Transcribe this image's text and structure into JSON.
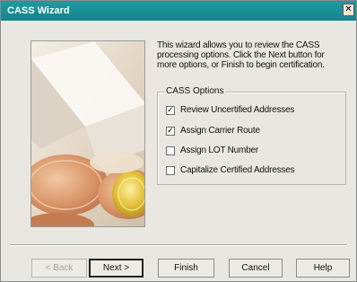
{
  "window": {
    "title": "CASS Wizard"
  },
  "intro_text": "This wizard allows you to review the CASS processing options. Click the Next button for more options, or Finish to begin certification.",
  "options_group": {
    "label": "CASS Options",
    "items": [
      {
        "label": "Review Uncertified Addresses",
        "checked": true
      },
      {
        "label": "Assign Carrier Route",
        "checked": true
      },
      {
        "label": "Assign LOT Number",
        "checked": false
      },
      {
        "label": "Capitalize Certified Addresses",
        "checked": false
      }
    ]
  },
  "buttons": {
    "back": "< Back",
    "next": "Next >",
    "finish": "Finish",
    "cancel": "Cancel",
    "help": "Help"
  },
  "icons": {
    "close": "close-icon",
    "checkbox": "checkmark-icon"
  },
  "colors": {
    "titlebar": "#1e9aa0",
    "dialog_bg": "#e9e7e1"
  }
}
